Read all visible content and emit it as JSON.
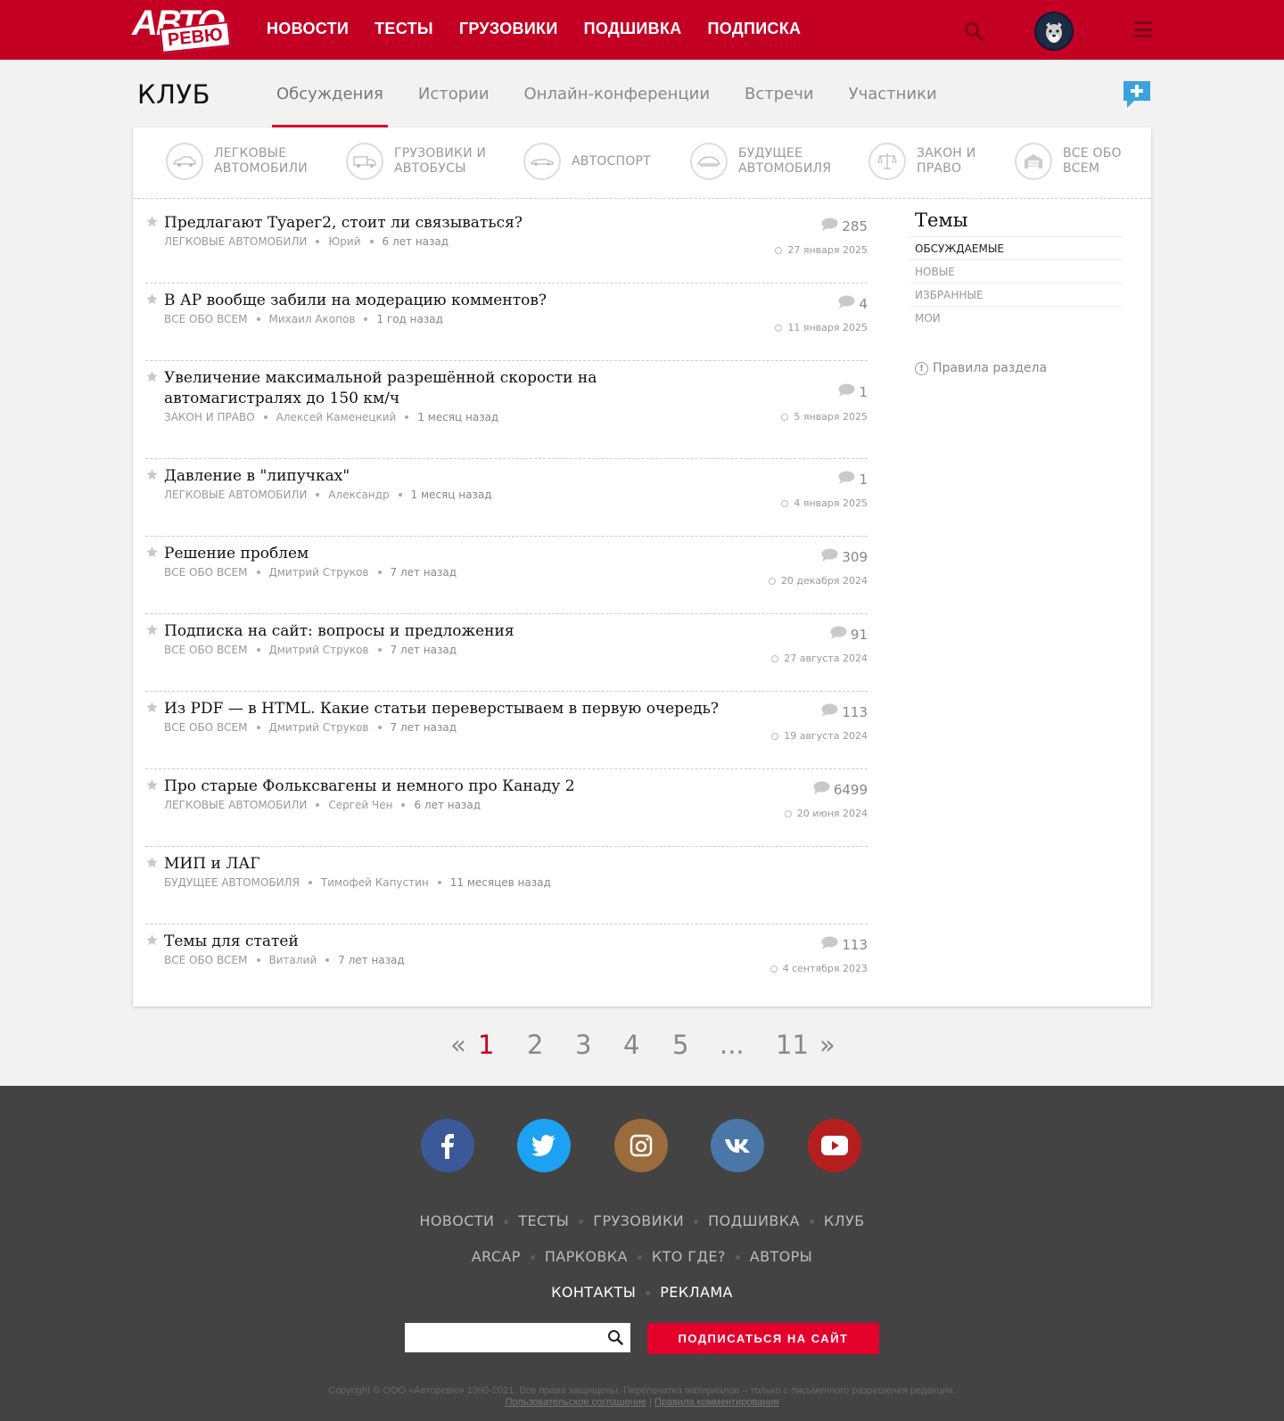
{
  "brand": {
    "logo_top": "АВТО",
    "logo_bottom": "РЕВЮ"
  },
  "header": {
    "nav": [
      "НОВОСТИ",
      "ТЕСТЫ",
      "ГРУЗОВИКИ",
      "ПОДШИВКА",
      "ПОДПИСКА"
    ],
    "icons": [
      "search-icon",
      "user-avatar",
      "menu-icon"
    ]
  },
  "club": {
    "title": "КЛУБ",
    "tabs": [
      "Обсуждения",
      "Истории",
      "Онлайн-конференции",
      "Встречи",
      "Участники"
    ],
    "active_tab": "Обсуждения"
  },
  "categories": [
    {
      "label": "ЛЕГКОВЫЕ АВТОМОБИЛИ",
      "icon": "car-icon"
    },
    {
      "label": "ГРУЗОВИКИ И АВТОБУСЫ",
      "icon": "truck-icon"
    },
    {
      "label": "АВТОСПОРТ",
      "icon": "race-car-icon"
    },
    {
      "label": "БУДУЩЕЕ АВТОМОБИЛЯ",
      "icon": "future-car-icon"
    },
    {
      "label": "ЗАКОН И ПРАВО",
      "icon": "scales-icon"
    },
    {
      "label": "ВСЕ ОБО ВСЕМ",
      "icon": "garage-icon"
    }
  ],
  "topics": [
    {
      "title": "Предлагают Туарег2, стоит ли связываться?",
      "category": "ЛЕГКОВЫЕ АВТОМОБИЛИ",
      "author": "Юрий",
      "age": "6 лет назад",
      "comments": "285",
      "date": "27 января 2025"
    },
    {
      "title": "В АР вообще забили на модерацию комментов?",
      "category": "ВСЕ ОБО ВСЕМ",
      "author": "Михаил Акопов",
      "age": "1 год назад",
      "comments": "4",
      "date": "11 января 2025"
    },
    {
      "title": "Увеличение максимальной разрешённой скорости на автомагистралях до 150 км/ч",
      "category": "ЗАКОН И ПРАВО",
      "author": "Алексей Каменецкий",
      "age": "1 месяц назад",
      "comments": "1",
      "date": "5 января 2025"
    },
    {
      "title": "Давление в \"липучках\"",
      "category": "ЛЕГКОВЫЕ АВТОМОБИЛИ",
      "author": "Александр",
      "age": "1 месяц назад",
      "comments": "1",
      "date": "4 января 2025"
    },
    {
      "title": "Решение проблем",
      "category": "ВСЕ ОБО ВСЕМ",
      "author": "Дмитрий Струков",
      "age": "7 лет назад",
      "comments": "309",
      "date": "20 декабря 2024"
    },
    {
      "title": "Подписка на сайт: вопросы и предложения",
      "category": "ВСЕ ОБО ВСЕМ",
      "author": "Дмитрий Струков",
      "age": "7 лет назад",
      "comments": "91",
      "date": "27 августа 2024"
    },
    {
      "title": "Из PDF — в HTML. Какие статьи переверстываем в первую очередь?",
      "category": "ВСЕ ОБО ВСЕМ",
      "author": "Дмитрий Струков",
      "age": "7 лет назад",
      "comments": "113",
      "date": "19 августа 2024"
    },
    {
      "title": "Про старые Фольксвагены и немного про Канаду 2",
      "category": "ЛЕГКОВЫЕ АВТОМОБИЛИ",
      "author": "Сергей Чен",
      "age": "6 лет назад",
      "comments": "6499",
      "date": "20 июня 2024"
    },
    {
      "title": "МИП и ЛАГ",
      "category": "БУДУЩЕЕ АВТОМОБИЛЯ",
      "author": "Тимофей Капустин",
      "age": "11 месяцев назад",
      "comments": "",
      "date": ""
    },
    {
      "title": "Темы для статей",
      "category": "ВСЕ ОБО ВСЕМ",
      "author": "Виталий",
      "age": "7 лет назад",
      "comments": "113",
      "date": "4 сентября 2023"
    }
  ],
  "sidebar": {
    "title": "Темы",
    "items": [
      "ОБСУЖДАЕМЫЕ",
      "НОВЫЕ",
      "ИЗБРАННЫЕ",
      "МОИ"
    ],
    "active_item": "ОБСУЖДАЕМЫЕ",
    "rules_label": "Правила раздела"
  },
  "pagination": {
    "prev": "«",
    "pages": [
      "1",
      "2",
      "3",
      "4",
      "5",
      "...",
      "11"
    ],
    "current": "1",
    "next": "»"
  },
  "footer": {
    "social": [
      "facebook-icon",
      "twitter-icon",
      "instagram-icon",
      "vk-icon",
      "youtube-icon"
    ],
    "nav_row1": [
      "НОВОСТИ",
      "ТЕСТЫ",
      "ГРУЗОВИКИ",
      "ПОДШИВКА",
      "КЛУБ"
    ],
    "nav_row2": [
      "ARCAP",
      "ПАРКОВКА",
      "КТО ГДЕ?",
      "АВТОРЫ"
    ],
    "nav_row3": [
      "КОНТАКТЫ",
      "РЕКЛАМА"
    ],
    "search_value": "",
    "subscribe_label": "ПОДПИСАТЬСЯ НА САЙТ",
    "copyright": "Copyright © ООО «Авторевю» 1990-2021. Все права защищены. Перепечатка материалов – только с письменного разрешения редакции.",
    "link_agreement": "Пользовательское соглашение",
    "link_sep": "|",
    "link_rules": "Правила комментирования"
  },
  "colors": {
    "brand_red": "#c30024",
    "accent_red": "#e3002b",
    "footer_bg": "#434343",
    "page_bg": "#f2f2f2",
    "new_topic_blue": "#3aa3de"
  }
}
